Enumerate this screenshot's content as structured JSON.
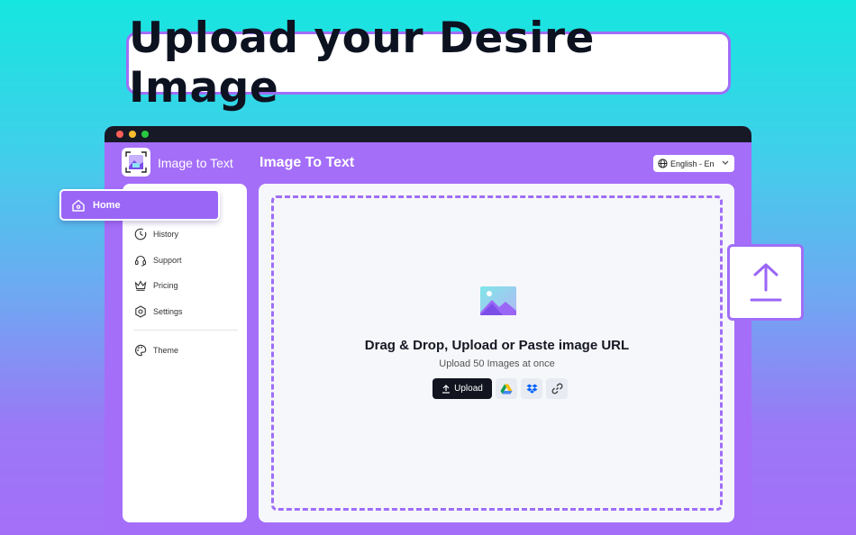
{
  "headline": "Upload your Desire Image",
  "app": {
    "name": "Image to Text",
    "page_title": "Image To Text",
    "language": "English - En"
  },
  "sidebar": {
    "items": [
      {
        "label": "Home",
        "icon": "home-icon",
        "active": true
      },
      {
        "label": "History",
        "icon": "history-icon"
      },
      {
        "label": "Support",
        "icon": "headset-icon"
      },
      {
        "label": "Pricing",
        "icon": "crown-icon"
      },
      {
        "label": "Settings",
        "icon": "settings-icon"
      },
      {
        "label": "Theme",
        "icon": "palette-icon"
      }
    ]
  },
  "dropzone": {
    "title": "Drag & Drop, Upload or Paste image URL",
    "subtitle": "Upload 50 Images at once",
    "upload_label": "Upload",
    "sources": [
      "google-drive-icon",
      "dropbox-icon",
      "link-icon"
    ]
  },
  "colors": {
    "accent": "#a06ef7",
    "dark": "#121420"
  }
}
